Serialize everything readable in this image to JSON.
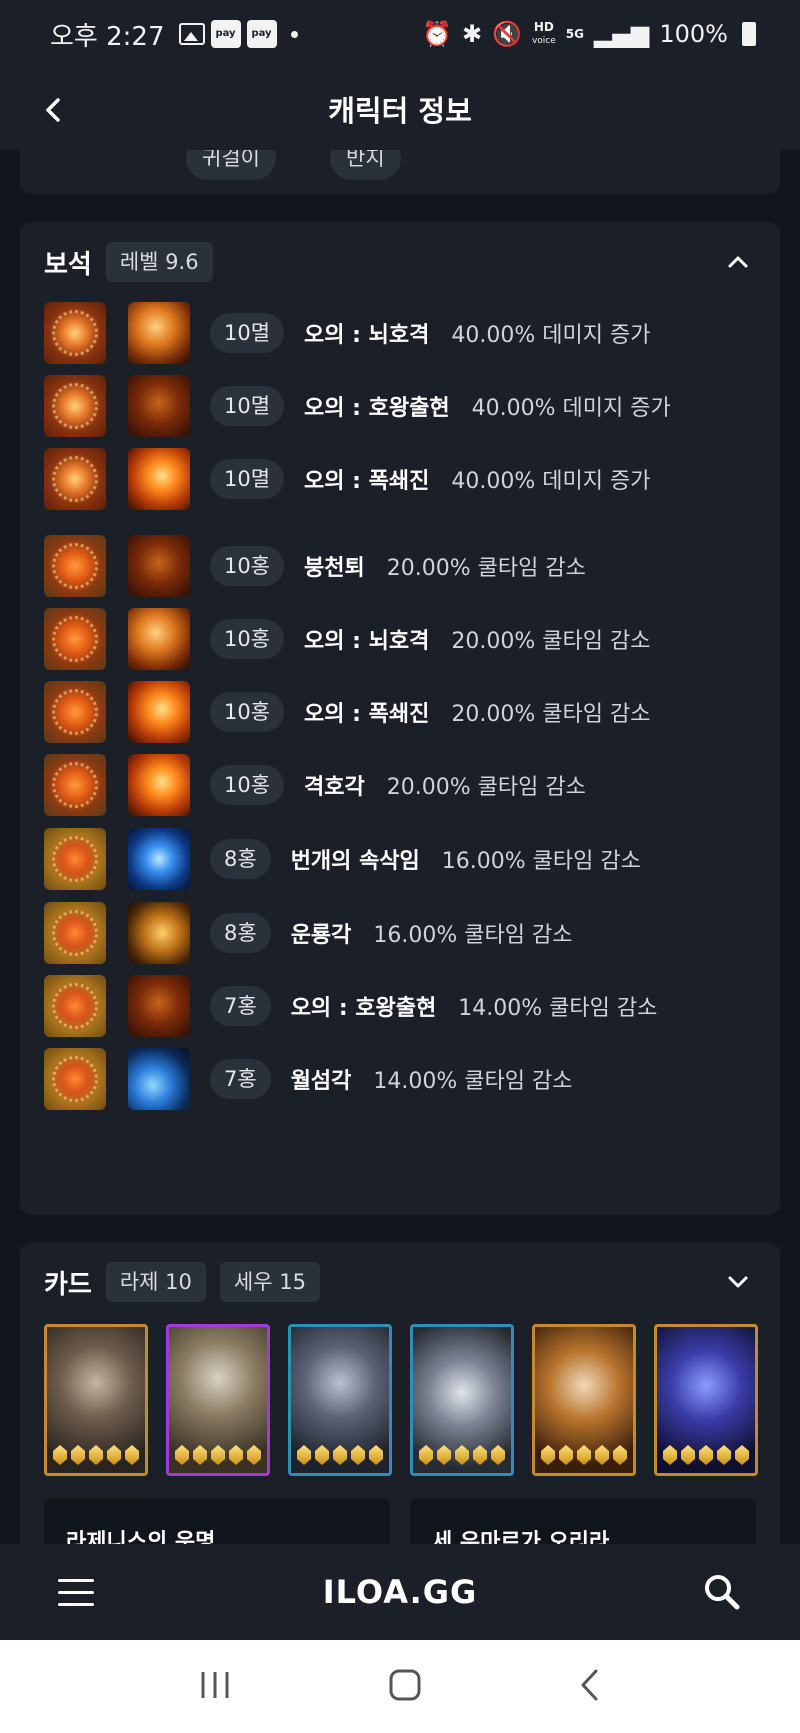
{
  "status_bar": {
    "time": "오후 2:27",
    "pay1": "pay",
    "pay2": "pay",
    "hd": "HD",
    "voice": "voice",
    "net": "5G",
    "battery": "100%"
  },
  "header": {
    "title": "캐릭터 정보"
  },
  "previous_section": {
    "chips": [
      "귀걸이",
      "반지"
    ]
  },
  "gems": {
    "title": "보석",
    "level_label": "레벨 9.6",
    "rows": [
      {
        "level": "10멸",
        "skill": "오의 : 뇌호격",
        "effect": "40.00% 데미지 증가",
        "gem_type": "damage",
        "skill_icon": "tiger-strike-icon"
      },
      {
        "level": "10멸",
        "skill": "오의 : 호왕출현",
        "effect": "40.00% 데미지 증가",
        "gem_type": "damage",
        "skill_icon": "tiger-king-icon"
      },
      {
        "level": "10멸",
        "skill": "오의 : 폭쇄진",
        "effect": "40.00% 데미지 증가",
        "gem_type": "damage",
        "skill_icon": "explosion-icon"
      },
      {
        "level": "10홍",
        "skill": "붕천퇴",
        "effect": "20.00% 쿨타임 감소",
        "gem_type": "cooldown",
        "skill_icon": "kick-icon"
      },
      {
        "level": "10홍",
        "skill": "오의 : 뇌호격",
        "effect": "20.00% 쿨타임 감소",
        "gem_type": "cooldown",
        "skill_icon": "tiger-strike-icon"
      },
      {
        "level": "10홍",
        "skill": "오의 : 폭쇄진",
        "effect": "20.00% 쿨타임 감소",
        "gem_type": "cooldown",
        "skill_icon": "explosion-icon"
      },
      {
        "level": "10홍",
        "skill": "격호각",
        "effect": "20.00% 쿨타임 감소",
        "gem_type": "cooldown",
        "skill_icon": "flame-kick-icon"
      },
      {
        "level": "8홍",
        "skill": "번개의 속삭임",
        "effect": "16.00% 쿨타임 감소",
        "gem_type": "cooldown-gold",
        "skill_icon": "lightning-icon"
      },
      {
        "level": "8홍",
        "skill": "운룡각",
        "effect": "16.00% 쿨타임 감소",
        "gem_type": "cooldown-gold",
        "skill_icon": "dragon-kick-icon"
      },
      {
        "level": "7홍",
        "skill": "오의 : 호왕출현",
        "effect": "14.00% 쿨타임 감소",
        "gem_type": "cooldown-gold",
        "skill_icon": "tiger-king-icon"
      },
      {
        "level": "7홍",
        "skill": "월섬각",
        "effect": "14.00% 쿨타임 감소",
        "gem_type": "cooldown-gold",
        "skill_icon": "moon-slash-icon"
      }
    ]
  },
  "cards": {
    "title": "카드",
    "set_chips": [
      "라제 10",
      "세우 15"
    ],
    "items": [
      {
        "portrait": "card-portrait-1",
        "frame": "gold",
        "awakening": 5
      },
      {
        "portrait": "card-portrait-2",
        "frame": "purple",
        "awakening": 5
      },
      {
        "portrait": "card-portrait-3",
        "frame": "blue",
        "awakening": 5
      },
      {
        "portrait": "card-portrait-4",
        "frame": "blue",
        "awakening": 5
      },
      {
        "portrait": "card-portrait-5",
        "frame": "gold",
        "awakening": 5
      },
      {
        "portrait": "card-portrait-6",
        "frame": "gold",
        "awakening": 5
      }
    ],
    "sets": [
      "라제니스의 운명",
      "세 우마르가 오리라"
    ]
  },
  "bottom_nav": {
    "logo": "ILOA.GG"
  },
  "colors": {
    "background": "#11151c",
    "card": "#1b1f27",
    "chip": "#2b313b",
    "frame_gold": "#c58a2a",
    "frame_purple": "#a23cd8",
    "frame_blue": "#2e8fb8"
  }
}
